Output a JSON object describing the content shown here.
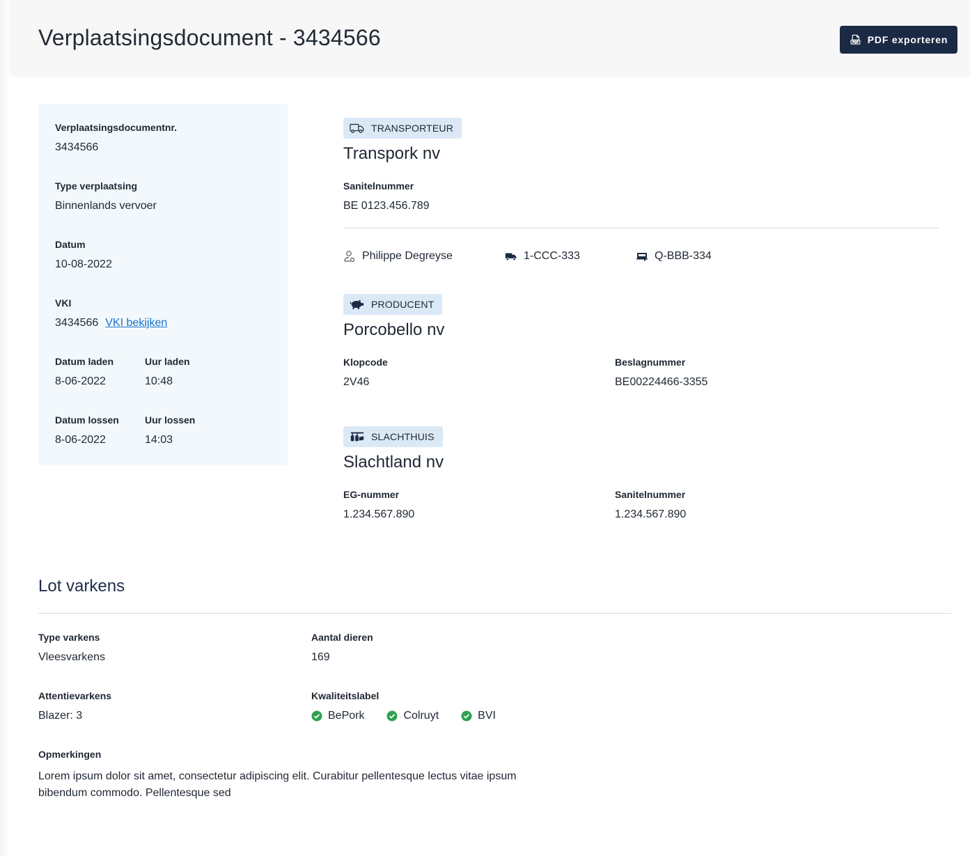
{
  "header": {
    "title": "Verplaatsingsdocument - 3434566",
    "pdf_button_label": "PDF exporteren"
  },
  "document_info": {
    "docnr_label": "Verplaatsingsdocumentnr.",
    "docnr_value": "3434566",
    "type_label": "Type verplaatsing",
    "type_value": "Binnenlands vervoer",
    "date_label": "Datum",
    "date_value": "10-08-2022",
    "vki_label": "VKI",
    "vki_value": "3434566",
    "vki_link": "VKI bekijken",
    "load_date_label": "Datum laden",
    "load_date_value": "8-06-2022",
    "load_time_label": "Uur laden",
    "load_time_value": "10:48",
    "unload_date_label": "Datum lossen",
    "unload_date_value": "8-06-2022",
    "unload_time_label": "Uur lossen",
    "unload_time_value": "14:03"
  },
  "transporteur": {
    "tag": "TRANSPORTEUR",
    "name": "Transpork nv",
    "sanitel_label": "Sanitelnummer",
    "sanitel_value": "BE 0123.456.789",
    "driver": "Philippe Degreyse",
    "truck_plate": "1-CCC-333",
    "trailer_plate": "Q-BBB-334"
  },
  "producent": {
    "tag": "PRODUCENT",
    "name": "Porcobello nv",
    "klopcode_label": "Klopcode",
    "klopcode_value": "2V46",
    "beslag_label": "Beslagnummer",
    "beslag_value": "BE00224466-3355"
  },
  "slachthuis": {
    "tag": "SLACHTHUIS",
    "name": "Slachtland nv",
    "eg_label": "EG-nummer",
    "eg_value": "1.234.567.890",
    "sanitel_label": "Sanitelnummer",
    "sanitel_value": "1.234.567.890"
  },
  "lot": {
    "title": "Lot varkens",
    "type_label": "Type varkens",
    "type_value": "Vleesvarkens",
    "count_label": "Aantal dieren",
    "count_value": "169",
    "attention_label": "Attentievarkens",
    "attention_value": "Blazer: 3",
    "quality_label": "Kwaliteitslabel",
    "quality_labels": [
      "BePork",
      "Colruyt",
      "BVI"
    ],
    "remarks_label": "Opmerkingen",
    "remarks_value": "Lorem ipsum dolor sit amet, consectetur adipiscing elit. Curabitur pellentesque lectus vitae ipsum bibendum commodo. Pellentesque sed"
  },
  "colors": {
    "accent_dark": "#1b2a44",
    "tag_bg": "#dbe8f6",
    "card_bg": "#f3f8fc",
    "link": "#1673c9",
    "check": "#2ea14f"
  },
  "icons": {
    "pdf": "pdf-file-icon",
    "transporteur": "truck-outline-icon",
    "producent": "pig-icon",
    "slachthuis": "slaughterhouse-icon",
    "driver": "person-icon",
    "truck": "truck-icon",
    "trailer": "trailer-icon",
    "quality": "check-circle-icon"
  }
}
